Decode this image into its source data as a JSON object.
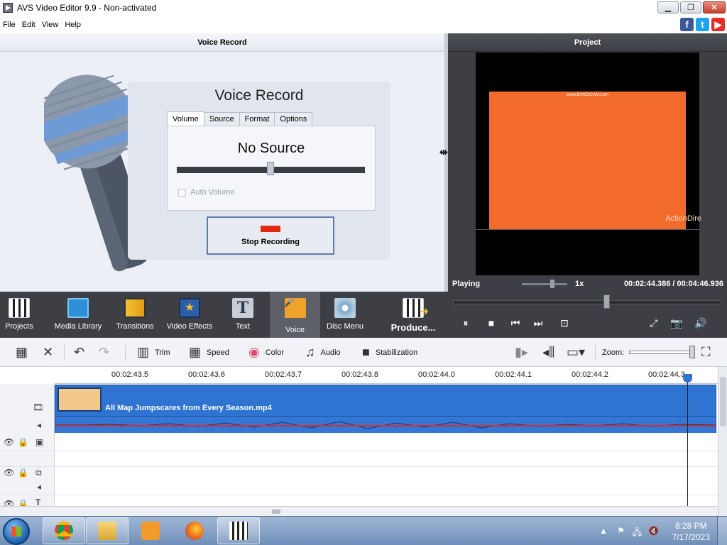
{
  "window": {
    "title": "AVS Video Editor 9.9 - Non-activated",
    "minimize": "▁",
    "maximize": "❐",
    "close": "✕"
  },
  "menu": [
    {
      "label": "File"
    },
    {
      "label": "Edit"
    },
    {
      "label": "View"
    },
    {
      "label": "Help"
    }
  ],
  "social": {
    "facebook": "f",
    "twitter": "t",
    "youtube": "▶"
  },
  "voice_panel": {
    "header": "Voice Record",
    "title": "Voice Record",
    "tabs": [
      {
        "label": "Volume"
      },
      {
        "label": "Source"
      },
      {
        "label": "Format"
      },
      {
        "label": "Options"
      }
    ],
    "active_tab": "Volume",
    "source_status": "No Source",
    "volume_level": 0.5,
    "auto_volume_label": "Auto Volume",
    "stop_button": "Stop Recording"
  },
  "project_panel": {
    "header": "Project",
    "watermark_top": "www.BANDICAM.com",
    "watermark_corner": "ActionDire",
    "status": "Playing",
    "speed": "1x",
    "time": "00:02:44.386 / 00:04:46.936",
    "preview_color": "#f26b2c"
  },
  "toolbar": {
    "items": [
      {
        "label": "Projects",
        "icon": "clapperboard-icon"
      },
      {
        "label": "Media Library",
        "icon": "film-library-icon"
      },
      {
        "label": "Transitions",
        "icon": "transitions-icon"
      },
      {
        "label": "Video Effects",
        "icon": "star-film-icon"
      },
      {
        "label": "Text",
        "icon": "text-icon",
        "glyph": "T"
      },
      {
        "label": "Voice",
        "icon": "microphone-icon",
        "active": true
      },
      {
        "label": "Disc Menu",
        "icon": "disc-icon"
      },
      {
        "label": "Produce...",
        "icon": "produce-icon"
      }
    ],
    "transport": {
      "pause": "⏸",
      "stop": "■",
      "prev": "⏮",
      "next": "⏭",
      "snap": "⊡"
    },
    "right_icons": {
      "fullscreen": "⤢",
      "snapshot": "📷",
      "volume": "🔊"
    }
  },
  "edit_toolbar": {
    "trim": "Trim",
    "speed": "Speed",
    "color": "Color",
    "audio": "Audio",
    "stabilization": "Stabilization",
    "zoom": "Zoom:"
  },
  "timeline": {
    "ticks": [
      "00:02:43.5",
      "00:02:43.6",
      "00:02:43.7",
      "00:02:43.8",
      "00:02:44.0",
      "00:02:44.1",
      "00:02:44.2",
      "00:02:44.3"
    ],
    "clip_name": "All Map Jumpscares from Every Season.mp4",
    "accent": "#2f74d0"
  },
  "taskbar": {
    "time": "8:28 PM",
    "date": "7/17/2023",
    "apps": [
      "chrome-icon",
      "file-explorer-icon",
      "media-player-icon",
      "firefox-icon",
      "avs-video-editor-icon"
    ]
  }
}
